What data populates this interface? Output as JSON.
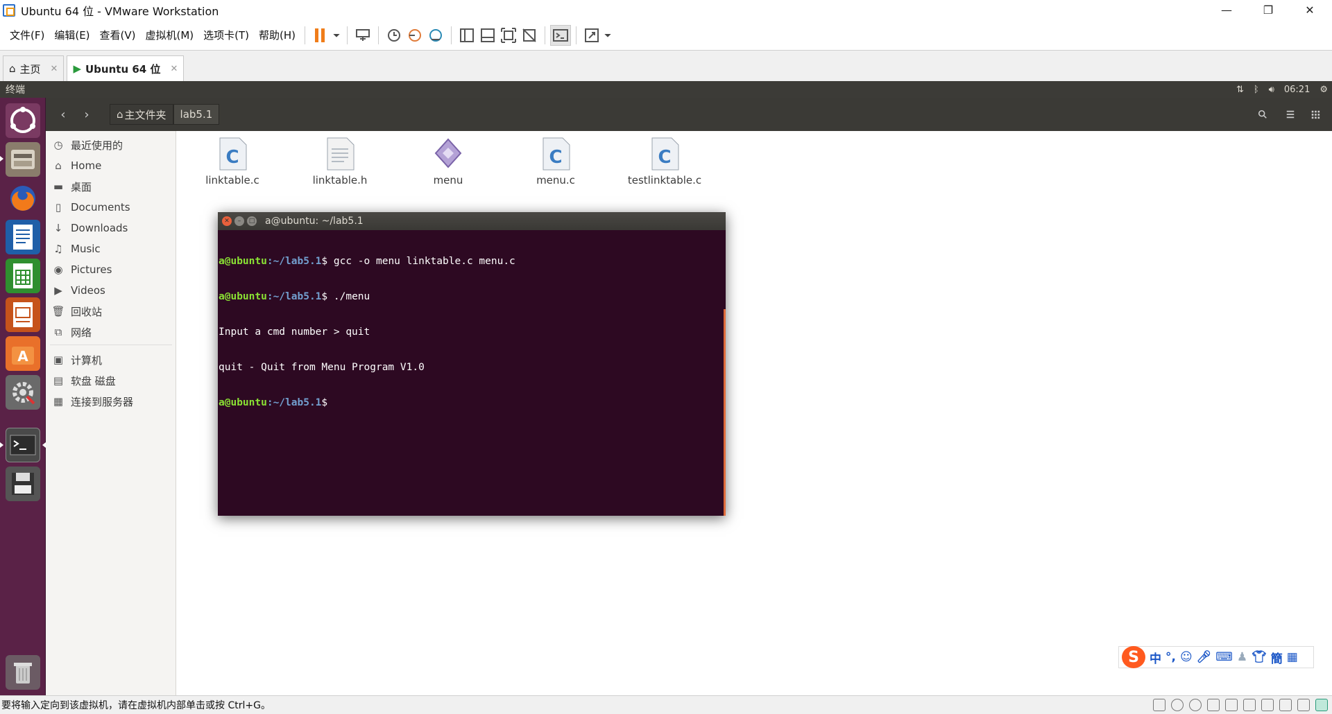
{
  "window": {
    "title": "Ubuntu 64 位 - VMware Workstation",
    "minimize": "—",
    "restore": "❐",
    "close": "✕"
  },
  "menu": [
    "文件(F)",
    "编辑(E)",
    "查看(V)",
    "虚拟机(M)",
    "选项卡(T)",
    "帮助(H)"
  ],
  "tabs": [
    {
      "label": "主页",
      "close": "✕"
    },
    {
      "label": "Ubuntu 64 位",
      "close": "✕"
    }
  ],
  "panel": {
    "title": "终端",
    "time": "06:21"
  },
  "nautilus": {
    "breadcrumb": [
      "主文件夹",
      "lab5.1"
    ],
    "sidebar": [
      "最近使用的",
      "Home",
      "桌面",
      "Documents",
      "Downloads",
      "Music",
      "Pictures",
      "Videos",
      "回收站",
      "网络",
      "计算机",
      "软盘 磁盘",
      "连接到服务器"
    ],
    "files": [
      {
        "name": "linktable.c",
        "icon": "c-source-icon"
      },
      {
        "name": "linktable.h",
        "icon": "header-file-icon"
      },
      {
        "name": "menu",
        "icon": "executable-icon"
      },
      {
        "name": "menu.c",
        "icon": "c-source-icon"
      },
      {
        "name": "testlinktable.c",
        "icon": "c-source-icon"
      }
    ]
  },
  "terminal": {
    "title": "a@ubuntu: ~/lab5.1",
    "user": "a@ubuntu",
    "path": ":~/lab5.1",
    "dollar": "$",
    "cmd1": " gcc -o menu linktable.c menu.c",
    "cmd2": " ./menu",
    "out1": "Input a cmd number > quit",
    "out2": "quit - Quit from Menu Program V1.0"
  },
  "ime": {
    "logo": "S",
    "mode": "中",
    "punct": "°,"
  },
  "status": {
    "text": "要将输入定向到该虚拟机，请在虚拟机内部单击或按 Ctrl+G。"
  }
}
